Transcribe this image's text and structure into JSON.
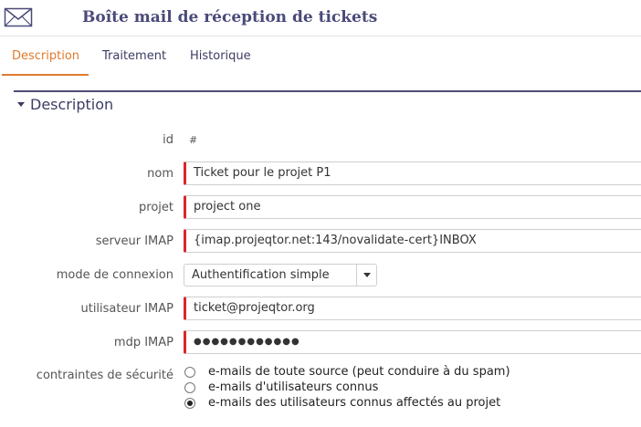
{
  "header": {
    "title": "Boîte mail de réception de tickets",
    "icon": "mail-icon"
  },
  "tabs": [
    {
      "label": "Description",
      "active": true
    },
    {
      "label": "Traitement",
      "active": false
    },
    {
      "label": "Historique",
      "active": false
    }
  ],
  "section": {
    "title": "Description"
  },
  "form": {
    "id_label": "id",
    "id_value": "#",
    "nom_label": "nom",
    "nom_value": "Ticket pour le projet P1",
    "projet_label": "projet",
    "projet_value": "project one",
    "serveur_label": "serveur IMAP",
    "serveur_value": "{imap.projeqtor.net:143/novalidate-cert}INBOX",
    "mode_label": "mode de connexion",
    "mode_value": "Authentification simple",
    "user_label": "utilisateur IMAP",
    "user_value": "ticket@projeqtor.org",
    "pwd_label": "mdp IMAP",
    "pwd_value": "●●●●●●●●●●●●",
    "security_label": "contraintes de sécurité",
    "security_options": [
      {
        "label": "e-mails de toute source (peut conduire à du spam)",
        "checked": false
      },
      {
        "label": "e-mails d'utilisateurs connus",
        "checked": false
      },
      {
        "label": "e-mails des utilisateurs connus affectés au projet",
        "checked": true
      }
    ]
  },
  "colors": {
    "accent": "#e07a2c",
    "title": "#4a4a7a",
    "required": "#d9262c"
  }
}
